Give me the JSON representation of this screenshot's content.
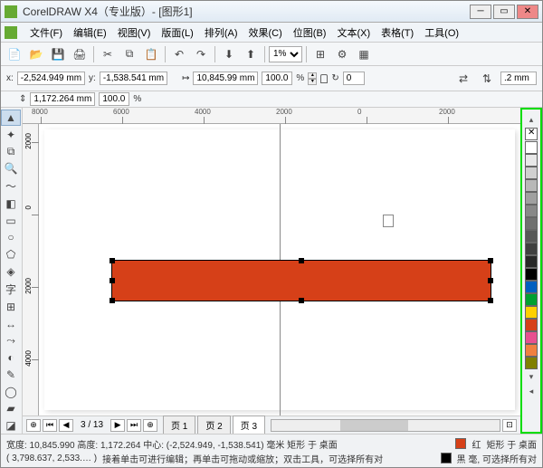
{
  "title": "CorelDRAW X4（专业版）- [图形1]",
  "menu": [
    "文件(F)",
    "编辑(E)",
    "视图(V)",
    "版面(L)",
    "排列(A)",
    "效果(C)",
    "位图(B)",
    "文本(X)",
    "表格(T)",
    "工具(O)"
  ],
  "zoom": "1%",
  "prop": {
    "x_label": "x:",
    "y_label": "y:",
    "x": "-2,524.949 mm",
    "y": "-1,538.541 mm",
    "w": "10,845.99 mm",
    "h": "1,172.264 mm",
    "sx": "100.0",
    "sy": "100.0",
    "pct": "%",
    "angle": "0",
    "stroke": ".2 mm"
  },
  "hruler": [
    "8000",
    "6000",
    "4000",
    "2000",
    "0",
    "2000"
  ],
  "vruler": [
    "2000",
    "0",
    "2000",
    "4000"
  ],
  "pagenav": {
    "counter": "3 / 13",
    "tabs": [
      "页 1",
      "页 2",
      "页 3"
    ],
    "active": 2
  },
  "status": {
    "line1": "宽度: 10,845.990  高度: 1,172.264  中心: (-2,524.949, -1,538.541) 毫米     矩形 于 桌面",
    "line2_coords": "( 3,798.637, 2,533.… )",
    "line2_hint": "接着单击可进行编辑；再单击可拖动或缩放；双击工具，可选择所有对",
    "fill_name": "红",
    "fill_desc": "矩形 于 桌面",
    "outline_name": "黑 毫, 可选择所有对"
  },
  "colors": {
    "fill": "#d64018",
    "outline": "#000000",
    "palette": [
      "#ffffff",
      "#e8e8e8",
      "#d0d0d0",
      "#b8b8b8",
      "#a0a0a0",
      "#888888",
      "#707070",
      "#585858",
      "#404040",
      "#282828",
      "#000000",
      "#0060c0",
      "#00a030",
      "#ffd000",
      "#d64018",
      "#e85090",
      "#f08040",
      "#808000"
    ]
  }
}
